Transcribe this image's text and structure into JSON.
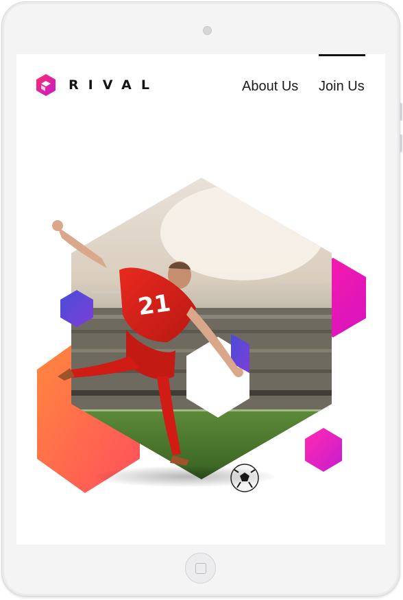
{
  "brand": {
    "name": "RIVAL",
    "colors": {
      "pink": "#e8128f",
      "magenta": "#c51cc9",
      "purple": "#5a3fd6",
      "teal": "#19b79a",
      "orange": "#ff7a3d"
    }
  },
  "nav": {
    "items": [
      {
        "label": "About Us"
      },
      {
        "label": "Join Us"
      }
    ],
    "active_index": 1
  },
  "hero": {
    "player_number": "21",
    "icons": [
      "hexagon-shape",
      "football-icon",
      "player-image"
    ]
  }
}
